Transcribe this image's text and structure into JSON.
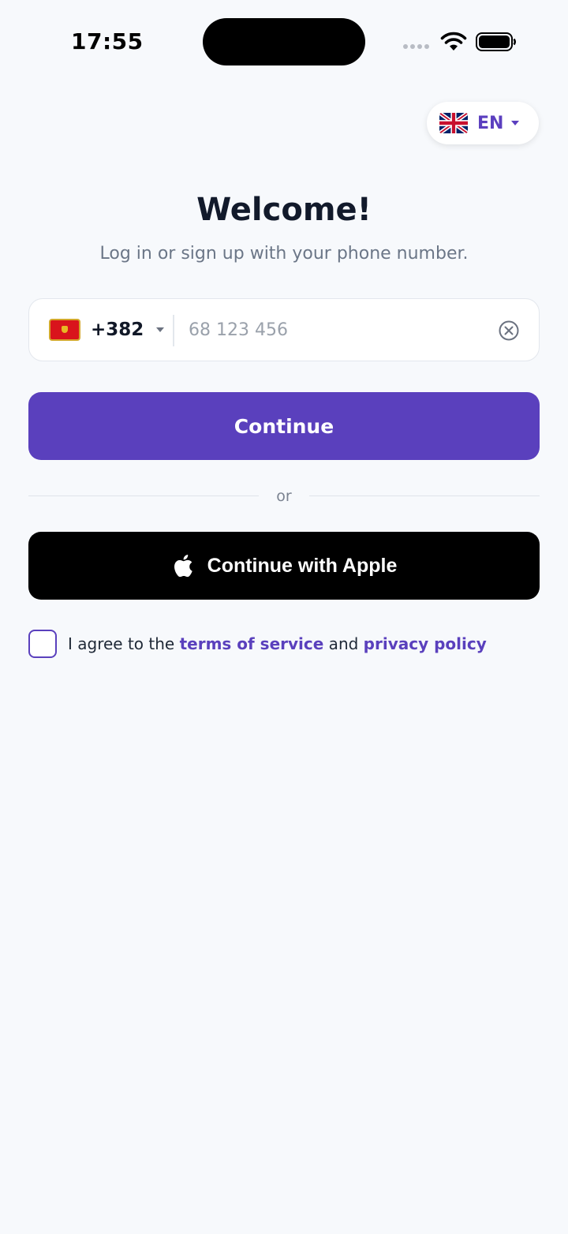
{
  "status_bar": {
    "time": "17:55"
  },
  "language": {
    "code": "EN",
    "flag": "uk-flag"
  },
  "header": {
    "title": "Welcome!",
    "subtitle": "Log in or sign up with your phone number."
  },
  "phone": {
    "country_flag": "montenegro-flag",
    "dial_code": "+382",
    "value": "",
    "placeholder": "68 123 456"
  },
  "continue_label": "Continue",
  "or_label": "or",
  "apple": {
    "label": "Continue with Apple"
  },
  "terms": {
    "prefix": "I agree to the ",
    "terms_link": "terms of service",
    "middle": " and ",
    "privacy_link": "privacy policy",
    "checked": false
  },
  "colors": {
    "accent": "#5a40bd",
    "background": "#f7f9fc",
    "apple_button": "#000000"
  }
}
